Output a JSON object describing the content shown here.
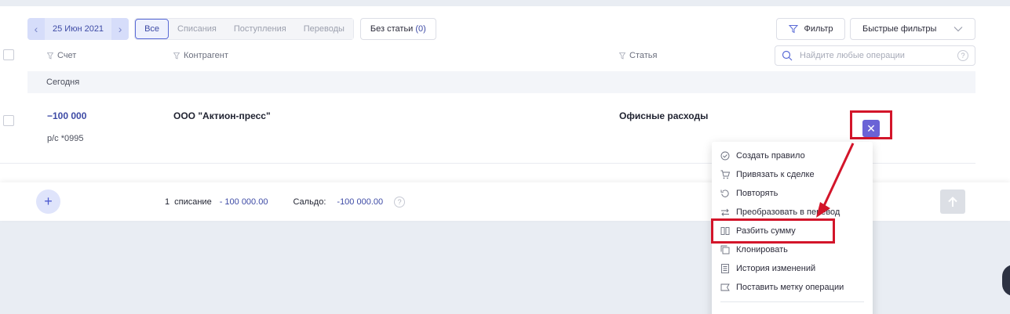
{
  "toolbar": {
    "date": "25 Июн 2021",
    "segments": [
      "Все",
      "Списания",
      "Поступления",
      "Переводы"
    ],
    "no_category_label": "Без статьи",
    "no_category_count": "(0)",
    "filter_label": "Фильтр",
    "quick_filters_label": "Быстрые фильтры"
  },
  "table": {
    "col_account": "Счет",
    "col_counterparty": "Контрагент",
    "col_category": "Статья",
    "search_placeholder": "Найдите любые операции",
    "group_label": "Сегодня",
    "row": {
      "amount": "−100 000",
      "account": "р/с *0995",
      "counterparty": "ООО \"Актион-пресс\"",
      "category": "Офисные расходы"
    }
  },
  "footer": {
    "count": "1",
    "count_word": "списание",
    "total": "- 100 000.00",
    "balance_label": "Сальдо:",
    "balance_value": "-100 000.00",
    "help": "?"
  },
  "menu": {
    "items": [
      {
        "label": "Создать правило",
        "icon": "check-circle-icon"
      },
      {
        "label": "Привязать к сделке",
        "icon": "cart-icon"
      },
      {
        "label": "Повторять",
        "icon": "repeat-icon"
      },
      {
        "label": "Преобразовать в перевод",
        "icon": "transfer-icon"
      },
      {
        "label": "Разбить сумму",
        "icon": "split-icon"
      },
      {
        "label": "Клонировать",
        "icon": "clone-icon"
      },
      {
        "label": "История изменений",
        "icon": "history-icon"
      },
      {
        "label": "Поставить метку операции",
        "icon": "tag-icon"
      }
    ]
  },
  "colors": {
    "accent": "#3d4aa5",
    "close_button": "#6b63d6",
    "highlight": "#d3152a"
  }
}
